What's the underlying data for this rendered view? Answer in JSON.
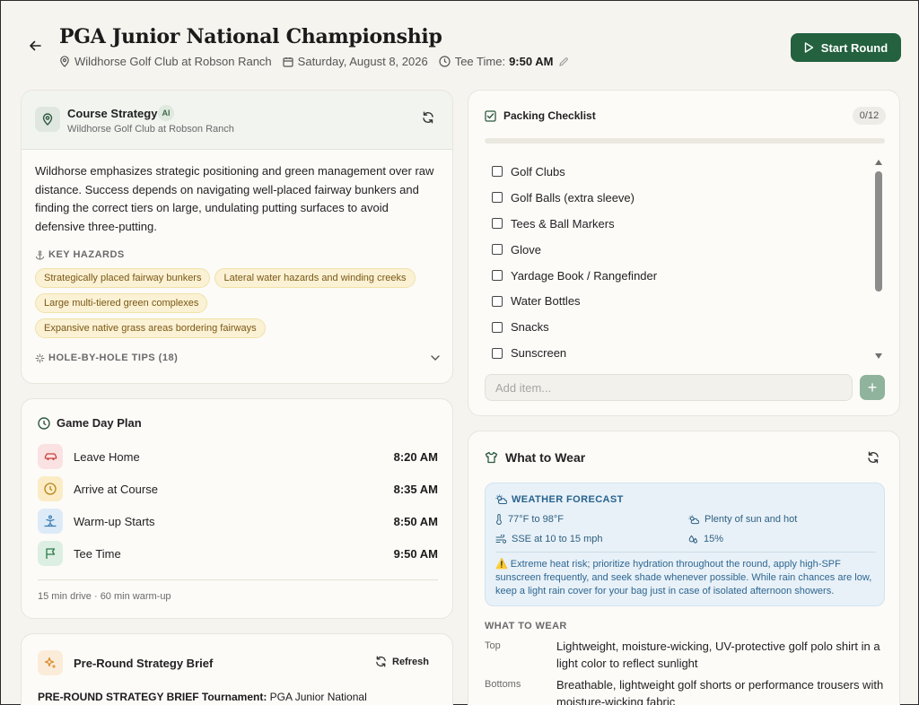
{
  "header": {
    "title": "PGA Junior National Championship",
    "location": "Wildhorse Golf Club at Robson Ranch",
    "date": "Saturday, August 8, 2026",
    "tee_time_label": "Tee Time:",
    "tee_time_value": "9:50 AM",
    "start_round_label": "Start Round"
  },
  "course_strategy": {
    "title": "Course Strategy",
    "ai_badge": "AI",
    "subtitle": "Wildhorse Golf Club at Robson Ranch",
    "body": "Wildhorse emphasizes strategic positioning and green management over raw distance. Success depends on navigating well-placed fairway bunkers and finding the correct tiers on large, undulating putting surfaces to avoid defensive three-putting.",
    "hazards_label": "KEY HAZARDS",
    "hazards": [
      "Strategically placed fairway bunkers",
      "Lateral water hazards and winding creeks",
      "Large multi-tiered green complexes",
      "Expansive native grass areas bordering fairways"
    ],
    "tips_label": "HOLE-BY-HOLE TIPS (18)"
  },
  "game_day": {
    "title": "Game Day Plan",
    "rows": [
      {
        "label": "Leave Home",
        "time": "8:20 AM"
      },
      {
        "label": "Arrive at Course",
        "time": "8:35 AM"
      },
      {
        "label": "Warm-up Starts",
        "time": "8:50 AM"
      },
      {
        "label": "Tee Time",
        "time": "9:50 AM"
      }
    ],
    "footer": "15 min drive · 60 min warm-up"
  },
  "brief": {
    "title": "Pre-Round Strategy Brief",
    "refresh_label": "Refresh",
    "text_bold": "PRE-ROUND STRATEGY BRIEF Tournament:",
    "text_rest": " PGA Junior National"
  },
  "packing": {
    "title": "Packing Checklist",
    "count": "0/12",
    "progress": 0,
    "items": [
      "Golf Clubs",
      "Golf Balls (extra sleeve)",
      "Tees & Ball Markers",
      "Glove",
      "Yardage Book / Rangefinder",
      "Water Bottles",
      "Snacks",
      "Sunscreen"
    ],
    "add_placeholder": "Add item...",
    "add_button": "+"
  },
  "wear": {
    "title": "What to Wear",
    "forecast_label": "WEATHER FORECAST",
    "temp": "77°F to 98°F",
    "sky": "Plenty of sun and hot",
    "wind": "SSE at 10 to 15 mph",
    "rain": "15%",
    "warning_icon": "⚠️",
    "warning": "Extreme heat risk; prioritize hydration throughout the round, apply high-SPF sunscreen frequently, and seek shade whenever possible. While rain chances are low, keep a light rain cover for your bag just in case of isolated afternoon showers.",
    "section_label": "WHAT TO WEAR",
    "items": [
      {
        "k": "Top",
        "v": "Lightweight, moisture-wicking, UV-protective golf polo shirt in a light color to reflect sunlight"
      },
      {
        "k": "Bottoms",
        "v": "Breathable, lightweight golf shorts or performance trousers with moisture-wicking fabric"
      }
    ]
  },
  "colors": {
    "accent": "#23613f",
    "chip_bg": "#fbf1d4",
    "weather_bg": "#e8f1f8"
  }
}
